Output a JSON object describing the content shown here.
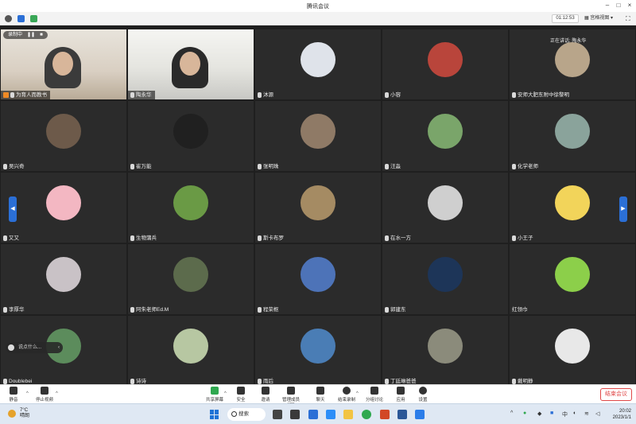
{
  "window": {
    "title": "腾讯会议"
  },
  "topbar": {
    "timer": "01:12:53",
    "view_label": "宫格视图"
  },
  "recording": {
    "label": "录制中"
  },
  "speaking": {
    "label": "正在讲话: 陶永华"
  },
  "participants": [
    {
      "name": "为育人而教书",
      "kind": "video1",
      "host": true
    },
    {
      "name": "陶永华",
      "kind": "video2"
    },
    {
      "name": "沐源",
      "color": "#dfe3ea"
    },
    {
      "name": "小容",
      "color": "#b9453b"
    },
    {
      "name": "安师大肥东附中徐黎明",
      "color": "#b8a58a"
    },
    {
      "name": "吴兴奇",
      "color": "#6d5a4a"
    },
    {
      "name": "崔万能",
      "color": "#202020"
    },
    {
      "name": "张明珠",
      "color": "#8f7a66"
    },
    {
      "name": "汪淼",
      "color": "#7aa56a"
    },
    {
      "name": "化学老师",
      "color": "#8aa39b"
    },
    {
      "name": "又又",
      "color": "#f3b7c2"
    },
    {
      "name": "生物蒲兵",
      "color": "#6a9a45"
    },
    {
      "name": "斯卡布罗",
      "color": "#a58b63"
    },
    {
      "name": "在水一方",
      "color": "#cfcfcf"
    },
    {
      "name": "小王子",
      "color": "#f2d45a"
    },
    {
      "name": "李厚华",
      "color": "#c9c2c6"
    },
    {
      "name": "阿朱老师Ed.M",
      "color": "#5c6b4c"
    },
    {
      "name": "程荣枢",
      "color": "#4d73b8"
    },
    {
      "name": "郭建东",
      "color": "#1d3558"
    },
    {
      "name": "红领巾",
      "color": "#8ccf4a",
      "nomic": true
    },
    {
      "name": "Doublebei",
      "color": "#5c8c5c"
    },
    {
      "name": "诗诗",
      "color": "#b7c7a2"
    },
    {
      "name": "雨后",
      "color": "#4a7db5"
    },
    {
      "name": "丁廷琳爸爸",
      "color": "#8b8b7b"
    },
    {
      "name": "戴明静",
      "color": "#e8e8e8"
    }
  ],
  "chat": {
    "placeholder": "说点什么..."
  },
  "toolbar": {
    "items": [
      {
        "label": "静音",
        "icon": "mic-icon"
      },
      {
        "label": "停止视频",
        "icon": "camera-icon"
      },
      {
        "label": "共享屏幕",
        "icon": "share-screen-icon"
      },
      {
        "label": "安全",
        "icon": "shield-icon"
      },
      {
        "label": "邀请",
        "icon": "invite-icon"
      },
      {
        "label": "管理成员(49)",
        "icon": "members-icon"
      },
      {
        "label": "聊天",
        "icon": "chat-icon"
      },
      {
        "label": "结束录制",
        "icon": "record-icon"
      },
      {
        "label": "分组讨论",
        "icon": "breakout-icon"
      },
      {
        "label": "应用",
        "icon": "apps-icon"
      },
      {
        "label": "设置",
        "icon": "gear-icon"
      }
    ],
    "end_label": "结束会议"
  },
  "taskbar": {
    "weather_temp": "7°C",
    "weather_desc": "晴朗",
    "search_label": "搜索",
    "lang": "中",
    "time": "20:02",
    "date": "2023/1/1"
  }
}
